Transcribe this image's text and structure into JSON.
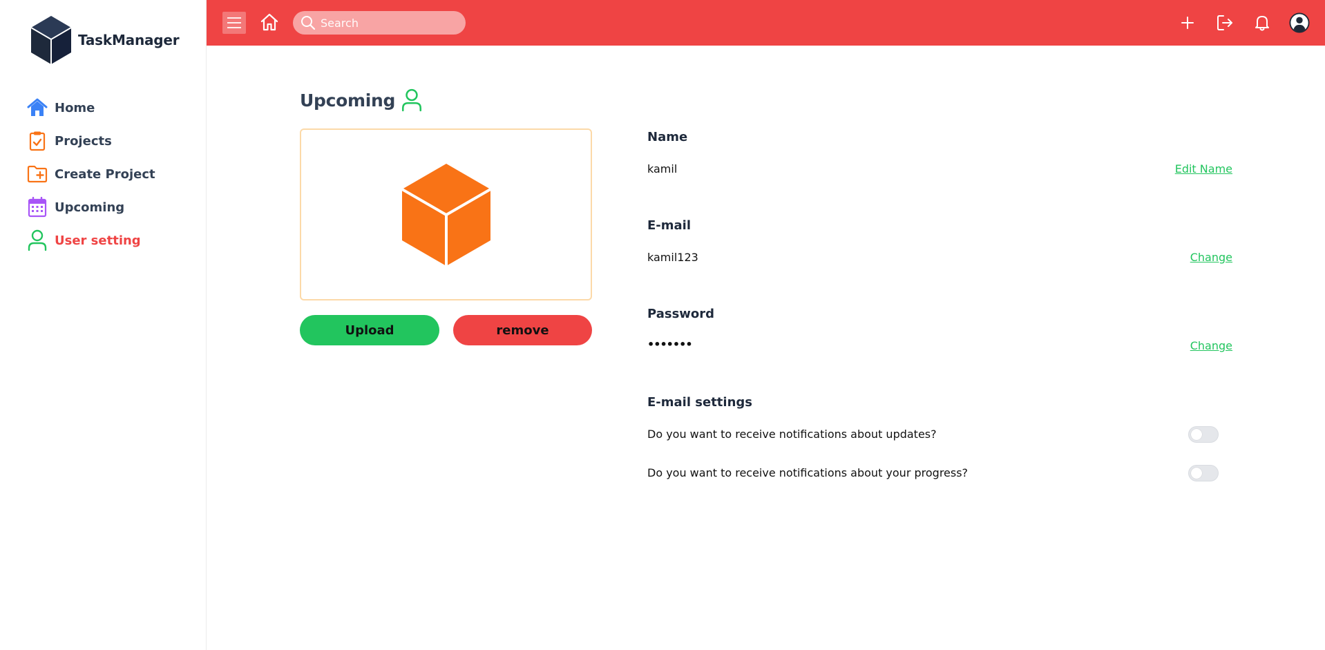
{
  "app": {
    "name": "TaskManager"
  },
  "sidebar": {
    "items": [
      {
        "label": "Home",
        "icon": "home-icon",
        "color": "#3b82f6",
        "active": false
      },
      {
        "label": "Projects",
        "icon": "clipboard-check-icon",
        "color": "#f97316",
        "active": false
      },
      {
        "label": "Create Project",
        "icon": "folder-plus-icon",
        "color": "#f97316",
        "active": false
      },
      {
        "label": "Upcoming",
        "icon": "calendar-icon",
        "color": "#a855f7",
        "active": false
      },
      {
        "label": "User setting",
        "icon": "user-icon",
        "color": "#22c55e",
        "active": true
      }
    ]
  },
  "topbar": {
    "search_placeholder": "Search",
    "icons": [
      "menu-icon",
      "home-icon",
      "search-icon",
      "plus-icon",
      "logout-icon",
      "bell-icon",
      "user-circle-icon"
    ],
    "background": "#ef4444"
  },
  "main": {
    "title": "Upcoming",
    "title_icon": "user-icon",
    "avatar_icon": "cube-icon",
    "upload_label": "Upload",
    "remove_label": "remove",
    "fields": {
      "name": {
        "label": "Name",
        "value": "kamil",
        "action": "Edit Name"
      },
      "email": {
        "label": "E-mail",
        "value": "kamil123",
        "action": "Change"
      },
      "password": {
        "label": "Password",
        "value": "•••••••",
        "action": "Change"
      }
    },
    "email_settings": {
      "label": "E-mail settings",
      "options": [
        {
          "question": "Do you want to receive notifications about updates?",
          "enabled": false
        },
        {
          "question": "Do you want to receive notifications about your progress?",
          "enabled": false
        }
      ]
    }
  },
  "colors": {
    "accent": "#ef4444",
    "success": "#22c55e",
    "brand_dark": "#1e293b",
    "orange": "#f97316"
  }
}
